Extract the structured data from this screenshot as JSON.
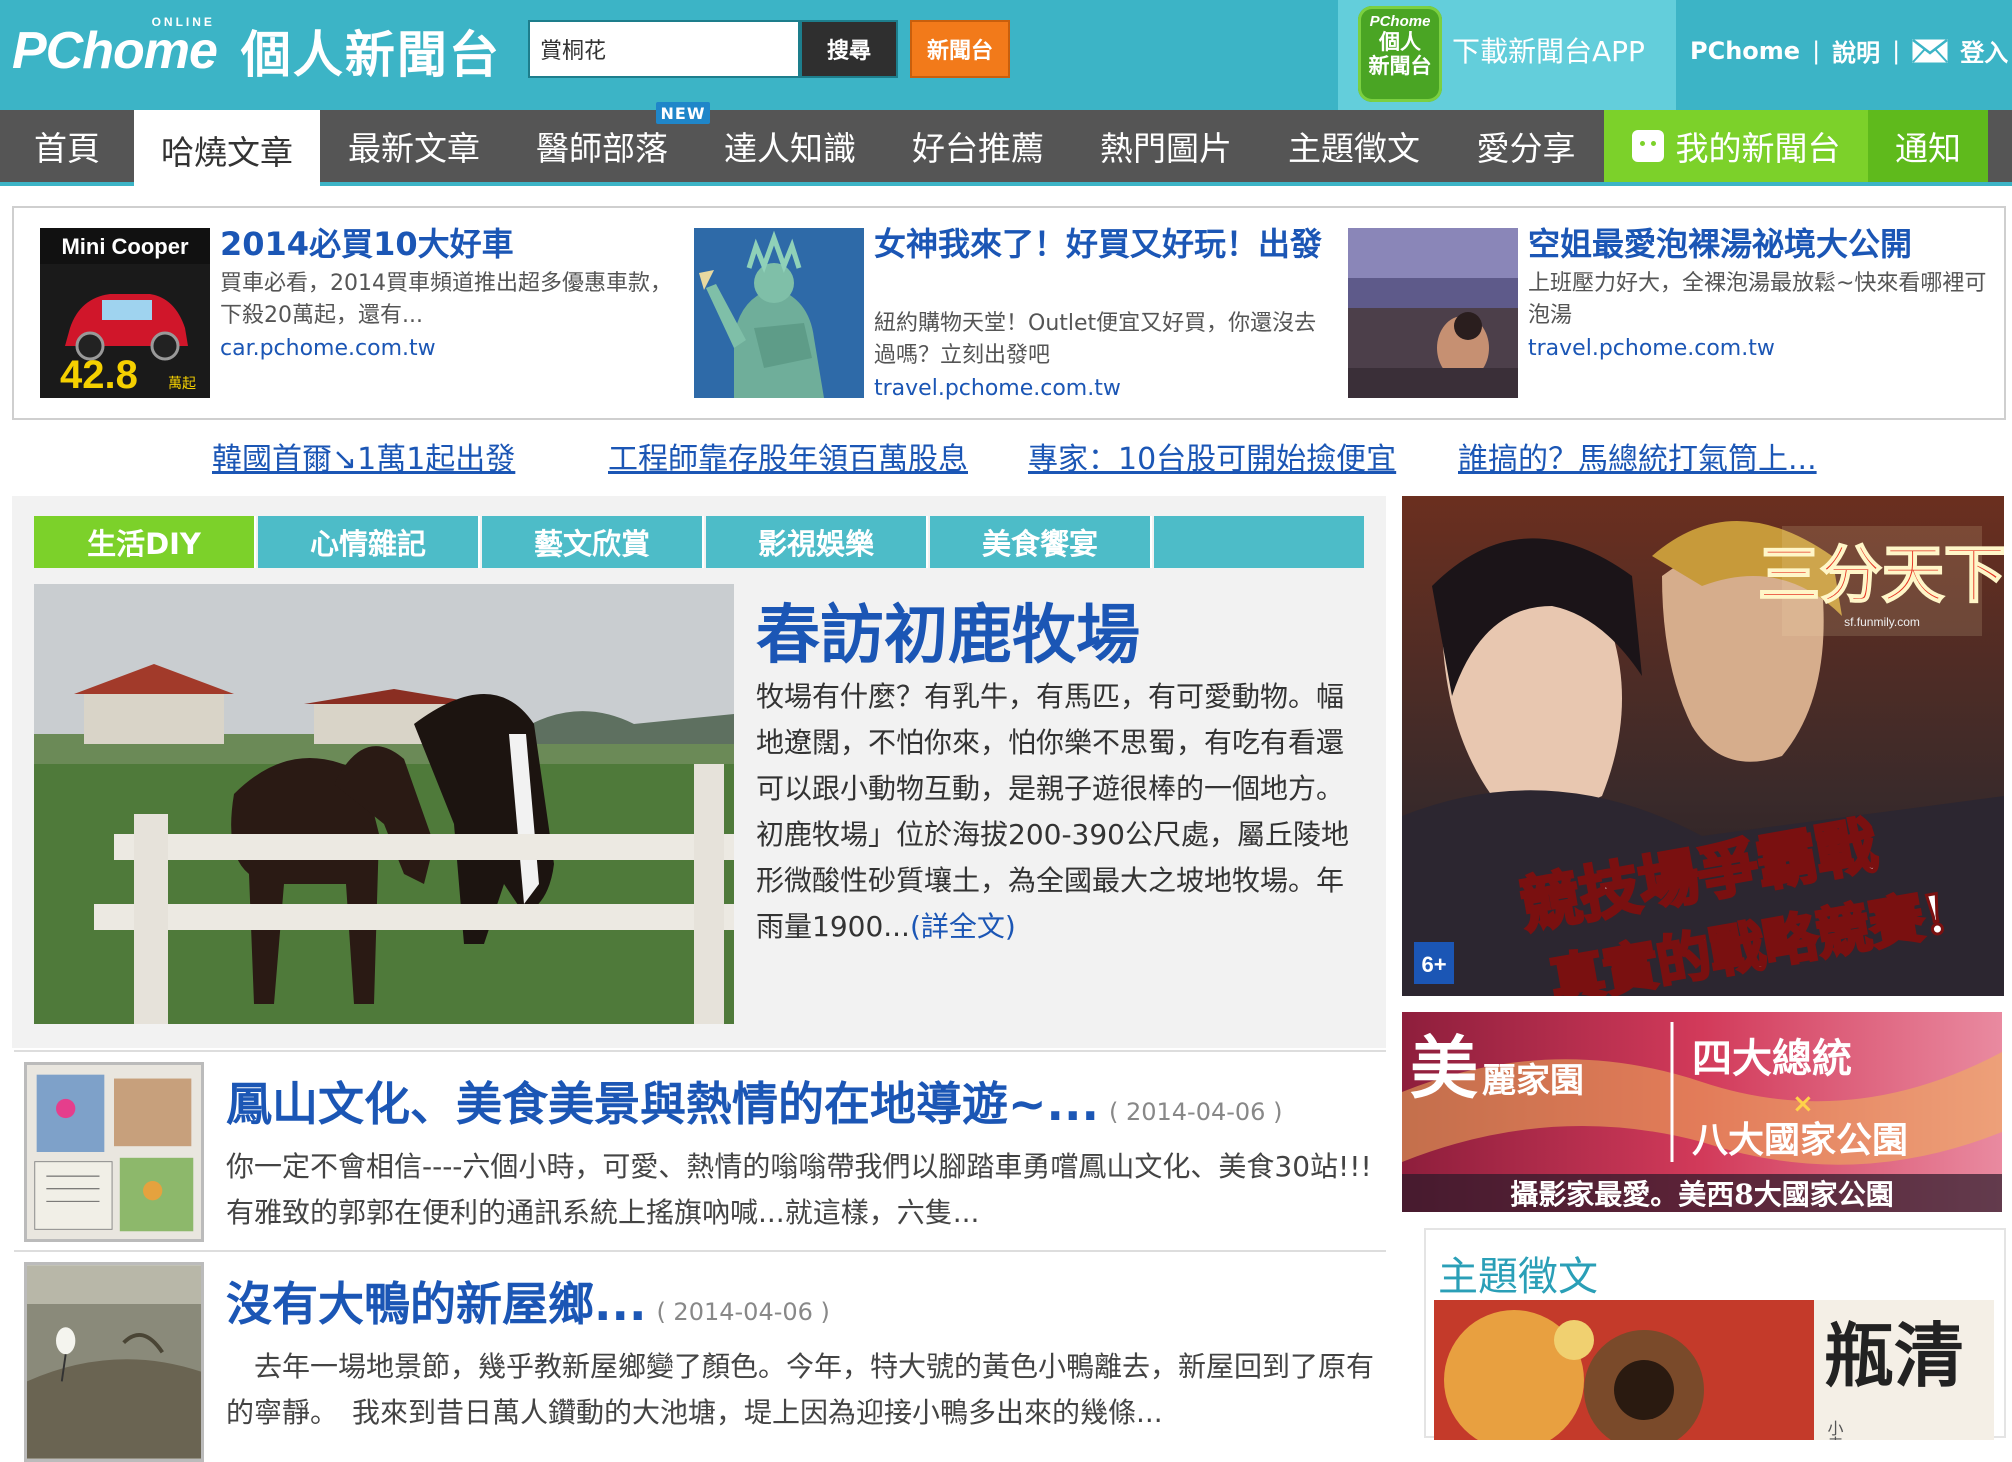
{
  "header": {
    "logo_text": "PChome",
    "logo_online": "ONLINE",
    "site_title": "個人新聞台",
    "search_value": "賞桐花",
    "search_button": "搜尋",
    "newsroom_button": "新聞台",
    "app_icon_brand": "PChome",
    "app_icon_line1": "個人",
    "app_icon_line2": "新聞台",
    "app_download": "下載新聞台APP",
    "link_pchome": "PChome",
    "sep": "|",
    "link_help": "說明",
    "link_login": "登入"
  },
  "nav": {
    "items": [
      {
        "label": "首頁"
      },
      {
        "label": "哈燒文章"
      },
      {
        "label": "最新文章"
      },
      {
        "label": "醫師部落"
      },
      {
        "label": "達人知識"
      },
      {
        "label": "好台推薦"
      },
      {
        "label": "熱門圖片"
      },
      {
        "label": "主題徵文"
      },
      {
        "label": "愛分享"
      }
    ],
    "new_badge": "NEW",
    "my_newsroom": "我的新聞台",
    "notify": "通知"
  },
  "ads": [
    {
      "image_label": "Mini Cooper",
      "image_price": "42.8",
      "image_unit": "萬起",
      "title": "2014必買10大好車",
      "desc": "買車必看，2014買車頻道推出超多優惠車款，下殺20萬起，還有...",
      "url": "car.pchome.com.tw"
    },
    {
      "title": "女神我來了！好買又好玩！出發",
      "desc": "紐約購物天堂！Outlet便宜又好買，你還沒去過嗎？立刻出發吧",
      "url": "travel.pchome.com.tw"
    },
    {
      "title": "空姐最愛泡裸湯祕境大公開",
      "desc": "上班壓力好大，全裸泡湯最放鬆~快來看哪裡可泡湯",
      "url": "travel.pchome.com.tw"
    }
  ],
  "headlines": [
    "韓國首爾↘1萬1起出發",
    "工程師靠存股年領百萬股息",
    "專家：10台股可開始撿便宜",
    "誰搞的？馬總統打氣筒上..."
  ],
  "categories": [
    "生活DIY",
    "心情雜記",
    "藝文欣賞",
    "影視娛樂",
    "美食饗宴"
  ],
  "feature": {
    "title": "春訪初鹿牧場",
    "text": "牧場有什麼？有乳牛，有馬匹，有可愛動物。幅地遼闊，不怕你來，怕你樂不思蜀，有吃有看還可以跟小動物互動，是親子遊很棒的一個地方。初鹿牧場」位於海拔200-390公尺處，屬丘陵地形微酸性砂質壤土，為全國最大之坡地牧場。年雨量1900...",
    "more": "(詳全文)"
  },
  "articles": [
    {
      "title": "鳳山文化、美食美景與熱情的在地導遊~...",
      "date": "( 2014-04-06 )",
      "text": "你一定不會相信----六個小時，可愛、熱情的嗡嗡帶我們以腳踏車勇嚐鳳山文化、美食30站!!!有雅致的郭郭在便利的通訊系統上搖旗吶喊...就這樣，六隻..."
    },
    {
      "title": "沒有大鴨的新屋鄉...",
      "date": "( 2014-04-06 )",
      "text": "　去年一場地景節，幾乎教新屋鄉變了顏色。今年，特大號的黃色小鴨離去，新屋回到了原有的寧靜。　我來到昔日萬人鑽動的大池塘，堤上因為迎接小鴨多出來的幾條..."
    }
  ],
  "sidebar": {
    "game_ad_title": "三分天下",
    "game_ad_slogan1": "競技場爭霸戰",
    "game_ad_slogan2": "真實的戰略競賽!",
    "game_ad_rating": "6+",
    "game_ad_site": "sf.funmily.com",
    "travel_ad_brand1": "美",
    "travel_ad_brand2": "麗家園",
    "travel_ad_line1": "四大總統",
    "travel_ad_x": "×",
    "travel_ad_line2": "八大國家公園",
    "travel_ad_bottom": "攝影家最愛。美西8大國家公園",
    "theme_title": "主題徵文",
    "theme_book": "瓶清",
    "theme_book_author": "小寺宮"
  },
  "colors": {
    "header_bg": "#3cb4c6",
    "nav_bg": "#555555",
    "accent_green": "#7cd12a",
    "link_blue": "#1b56b5",
    "orange": "#f27a1a",
    "tab_teal": "#4dbcc8"
  }
}
